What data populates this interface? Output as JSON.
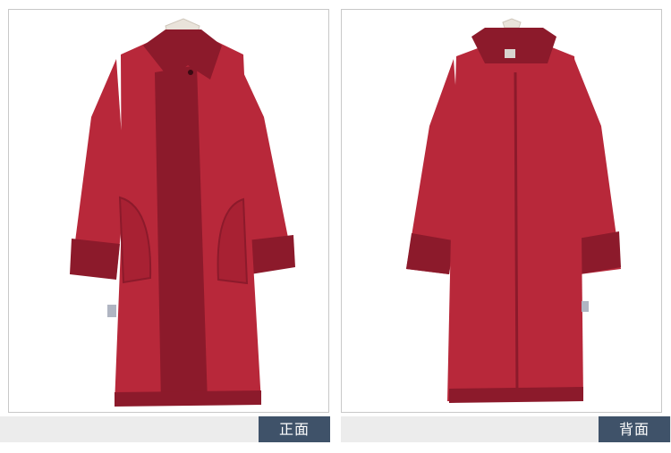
{
  "colors": {
    "coat": "#b8283a",
    "coat_dark": "#8c1a2b",
    "coat_deep": "#6f1221",
    "panel_border": "#c8c8c8",
    "bar_bg": "#ececec",
    "tag_bg": "#3f5269",
    "tag_text": "#ffffff"
  },
  "front": {
    "label": "正面",
    "image_icon": "red-coat-front-photo"
  },
  "back": {
    "label": "背面",
    "image_icon": "red-coat-back-photo"
  }
}
